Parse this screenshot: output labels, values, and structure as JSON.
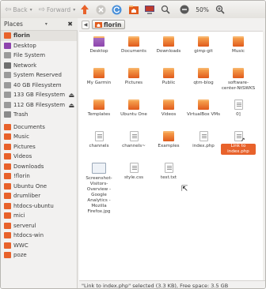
{
  "toolbar": {
    "back_label": "Back",
    "forward_label": "Forward",
    "zoom": "50%"
  },
  "sidebar": {
    "header": "Places",
    "items": [
      {
        "label": "florin",
        "icon": "home-icon",
        "color": "#e8622b",
        "selected": true
      },
      {
        "label": "Desktop",
        "icon": "desktop-icon",
        "color": "#8e44ad"
      },
      {
        "label": "File System",
        "icon": "drive-icon",
        "color": "#9a9a9a"
      },
      {
        "label": "Network",
        "icon": "network-icon",
        "color": "#6f6f6f"
      },
      {
        "label": "System Reserved",
        "icon": "drive-icon",
        "color": "#9a9a9a"
      },
      {
        "label": "40 GB Filesystem",
        "icon": "drive-icon",
        "color": "#9a9a9a"
      },
      {
        "label": "133 GB Filesystem",
        "icon": "drive-icon",
        "color": "#9a9a9a",
        "eject": true
      },
      {
        "label": "112 GB Filesystem",
        "icon": "drive-icon",
        "color": "#9a9a9a",
        "eject": true
      },
      {
        "label": "Trash",
        "icon": "trash-icon",
        "color": "#8a8a8a"
      },
      {
        "label": "Documents",
        "icon": "folder-icon",
        "color": "#e8622b",
        "gap": true
      },
      {
        "label": "Music",
        "icon": "folder-icon",
        "color": "#e8622b"
      },
      {
        "label": "Pictures",
        "icon": "folder-icon",
        "color": "#e8622b"
      },
      {
        "label": "Videos",
        "icon": "folder-icon",
        "color": "#e8622b"
      },
      {
        "label": "Downloads",
        "icon": "folder-icon",
        "color": "#e8622b"
      },
      {
        "label": "!florin",
        "icon": "folder-icon",
        "color": "#e8622b"
      },
      {
        "label": "Ubuntu One",
        "icon": "folder-icon",
        "color": "#e8622b"
      },
      {
        "label": "drumliber",
        "icon": "folder-icon",
        "color": "#e8622b"
      },
      {
        "label": "htdocs-ubuntu",
        "icon": "folder-icon",
        "color": "#e8622b"
      },
      {
        "label": "mici",
        "icon": "folder-icon",
        "color": "#e8622b"
      },
      {
        "label": "serverul",
        "icon": "folder-icon",
        "color": "#e8622b"
      },
      {
        "label": "htdocs-win",
        "icon": "folder-icon",
        "color": "#e8622b"
      },
      {
        "label": "WWC",
        "icon": "folder-icon",
        "color": "#e8622b"
      },
      {
        "label": "poze",
        "icon": "folder-icon",
        "color": "#e8622b"
      }
    ]
  },
  "location": {
    "crumb": "florin"
  },
  "files": [
    {
      "label": "Desktop",
      "kind": "folder",
      "accent": "#8e44ad"
    },
    {
      "label": "Documents",
      "kind": "folder"
    },
    {
      "label": "Downloads",
      "kind": "folder"
    },
    {
      "label": "gimp-git",
      "kind": "folder"
    },
    {
      "label": "Music",
      "kind": "folder"
    },
    {
      "label": "My Garmin",
      "kind": "folder"
    },
    {
      "label": "Pictures",
      "kind": "folder"
    },
    {
      "label": "Public",
      "kind": "folder"
    },
    {
      "label": "qtm-blog",
      "kind": "folder"
    },
    {
      "label": "software-center-NtSWKS",
      "kind": "folder"
    },
    {
      "label": "Templates",
      "kind": "folder"
    },
    {
      "label": "Ubuntu One",
      "kind": "folder"
    },
    {
      "label": "Videos",
      "kind": "folder"
    },
    {
      "label": "VirtualBox VMs",
      "kind": "folder"
    },
    {
      "label": "0]",
      "kind": "file"
    },
    {
      "label": "channels",
      "kind": "file"
    },
    {
      "label": "channels~",
      "kind": "file"
    },
    {
      "label": "Examples",
      "kind": "folder"
    },
    {
      "label": "index.php",
      "kind": "file"
    },
    {
      "label": "Link to index.php",
      "kind": "link",
      "selected": true
    },
    {
      "label": "Screenshot-Visitors-Overview - Google Analytics - Mozilla Firefox.jpg",
      "kind": "image"
    },
    {
      "label": "style.css",
      "kind": "file"
    },
    {
      "label": "test.txt",
      "kind": "file"
    }
  ],
  "status": "\"Link to index.php\" selected (3.3 KB), Free space: 3.5 GB"
}
